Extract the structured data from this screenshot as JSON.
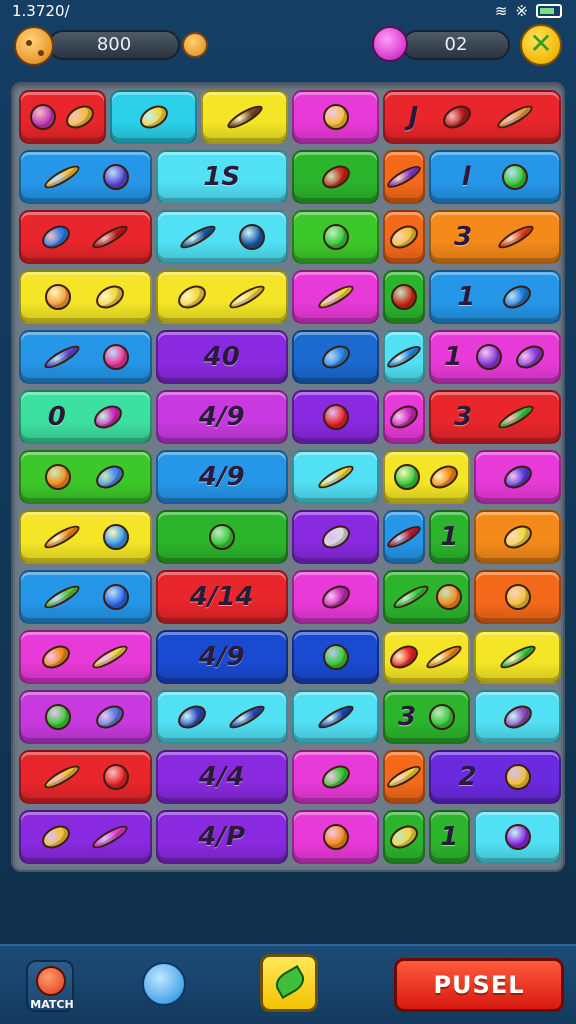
{
  "status": {
    "time": "1.3720/",
    "wifi_icon": "wifi-icon",
    "signal_icon": "signal-icon",
    "battery_icon": "battery-icon"
  },
  "topbar": {
    "coins": "800",
    "gems": "02"
  },
  "board": {
    "tiles": [
      {
        "col": 1,
        "row": 1,
        "span": 2,
        "color": "#e8262b",
        "text": "",
        "glyphs": [
          "#c23ab8",
          "#f4c03a"
        ]
      },
      {
        "col": 3,
        "row": 1,
        "span": 2,
        "color": "#2bd0e8",
        "text": "",
        "glyphs": [
          "#f4d640"
        ]
      },
      {
        "col": 5,
        "row": 1,
        "span": 2,
        "color": "#f4e626",
        "text": "",
        "glyphs": [
          "#7a4a22"
        ]
      },
      {
        "col": 7,
        "row": 1,
        "span": 2,
        "color": "#e83ad8",
        "text": "",
        "glyphs": [
          "#f4c03a"
        ]
      },
      {
        "col": 9,
        "row": 1,
        "span": 4,
        "color": "#e8262b",
        "text": "J",
        "glyphs": [
          "#b81a1a",
          "#e8a040"
        ]
      },
      {
        "col": 1,
        "row": 2,
        "span": 3,
        "color": "#2596e8",
        "text": "",
        "glyphs": [
          "#f4c03a",
          "#5a4ad8"
        ]
      },
      {
        "col": 4,
        "row": 2,
        "span": 3,
        "color": "#52e0f4",
        "text": "1S",
        "glyphs": []
      },
      {
        "col": 7,
        "row": 2,
        "span": 2,
        "color": "#2cb52c",
        "text": "",
        "glyphs": [
          "#c82a1a"
        ]
      },
      {
        "col": 9,
        "row": 2,
        "span": 1,
        "color": "#f46a1a",
        "text": "",
        "glyphs": [
          "#8a3ad8"
        ]
      },
      {
        "col": 10,
        "row": 2,
        "span": 3,
        "color": "#2596e8",
        "text": "l",
        "glyphs": [
          "#3ac83a"
        ]
      },
      {
        "col": 1,
        "row": 3,
        "span": 3,
        "color": "#e8262b",
        "text": "",
        "glyphs": [
          "#2a7ae8",
          "#c81a1a"
        ]
      },
      {
        "col": 4,
        "row": 3,
        "span": 3,
        "color": "#52e0f4",
        "text": "",
        "glyphs": [
          "#1a5aa8",
          "#1a5aa8"
        ]
      },
      {
        "col": 7,
        "row": 3,
        "span": 2,
        "color": "#3cc82a",
        "text": "",
        "glyphs": [
          "#3ac83a"
        ]
      },
      {
        "col": 9,
        "row": 3,
        "span": 1,
        "color": "#f46a1a",
        "text": "",
        "glyphs": [
          "#f4c03a"
        ]
      },
      {
        "col": 10,
        "row": 3,
        "span": 3,
        "color": "#f48a1a",
        "text": "3",
        "glyphs": [
          "#e8401a"
        ]
      },
      {
        "col": 1,
        "row": 4,
        "span": 3,
        "color": "#f4e626",
        "text": "",
        "glyphs": [
          "#f4a03a",
          "#f4d640"
        ]
      },
      {
        "col": 4,
        "row": 4,
        "span": 3,
        "color": "#f4e626",
        "text": "",
        "glyphs": [
          "#f4d640",
          "#f4d640"
        ]
      },
      {
        "col": 7,
        "row": 4,
        "span": 2,
        "color": "#e83ad8",
        "text": "",
        "glyphs": [
          "#f4d640"
        ]
      },
      {
        "col": 9,
        "row": 4,
        "span": 1,
        "color": "#2cb52c",
        "text": "",
        "glyphs": [
          "#c82a1a"
        ]
      },
      {
        "col": 10,
        "row": 4,
        "span": 3,
        "color": "#2596e8",
        "text": "1",
        "glyphs": [
          "#1a7ad8"
        ]
      },
      {
        "col": 1,
        "row": 5,
        "span": 3,
        "color": "#2596e8",
        "text": "",
        "glyphs": [
          "#5a4ad8",
          "#e83a9a"
        ]
      },
      {
        "col": 4,
        "row": 5,
        "span": 3,
        "color": "#8a2ae0",
        "text": "40",
        "glyphs": []
      },
      {
        "col": 7,
        "row": 5,
        "span": 2,
        "color": "#1a6ad0",
        "text": "",
        "glyphs": [
          "#2a8ae8"
        ]
      },
      {
        "col": 9,
        "row": 5,
        "span": 1,
        "color": "#52e0f4",
        "text": "",
        "glyphs": [
          "#2a8ae8"
        ]
      },
      {
        "col": 10,
        "row": 5,
        "span": 3,
        "color": "#e83ad8",
        "text": "1",
        "glyphs": [
          "#8a3ad8",
          "#8a3ad8"
        ]
      },
      {
        "col": 1,
        "row": 6,
        "span": 3,
        "color": "#3ce0a0",
        "text": "0",
        "glyphs": [
          "#c82ab8"
        ]
      },
      {
        "col": 4,
        "row": 6,
        "span": 3,
        "color": "#c83ae0",
        "text": "4/9",
        "glyphs": []
      },
      {
        "col": 7,
        "row": 6,
        "span": 2,
        "color": "#8a2ae0",
        "text": "",
        "glyphs": [
          "#e8262b"
        ]
      },
      {
        "col": 9,
        "row": 6,
        "span": 1,
        "color": "#e83ad8",
        "text": "",
        "glyphs": [
          "#c82ab8"
        ]
      },
      {
        "col": 10,
        "row": 6,
        "span": 3,
        "color": "#e8262b",
        "text": "3",
        "glyphs": [
          "#3ac83a"
        ]
      },
      {
        "col": 1,
        "row": 7,
        "span": 3,
        "color": "#3cc82a",
        "text": "",
        "glyphs": [
          "#f48a1a",
          "#4a8ae8"
        ]
      },
      {
        "col": 4,
        "row": 7,
        "span": 3,
        "color": "#2596e8",
        "text": "4/9",
        "glyphs": []
      },
      {
        "col": 7,
        "row": 7,
        "span": 2,
        "color": "#52e0f4",
        "text": "",
        "glyphs": [
          "#f4d640"
        ]
      },
      {
        "col": 9,
        "row": 7,
        "span": 2,
        "color": "#f4e626",
        "text": "",
        "glyphs": [
          "#3ac83a",
          "#f48a1a"
        ]
      },
      {
        "col": 11,
        "row": 7,
        "span": 2,
        "color": "#e83ad8",
        "text": "",
        "glyphs": [
          "#5a3ad8"
        ]
      },
      {
        "col": 1,
        "row": 8,
        "span": 3,
        "color": "#f4e626",
        "text": "",
        "glyphs": [
          "#f48a1a",
          "#3a9ae8"
        ]
      },
      {
        "col": 4,
        "row": 8,
        "span": 3,
        "color": "#2cb52c",
        "text": "",
        "glyphs": [
          "#3ac83a"
        ]
      },
      {
        "col": 7,
        "row": 8,
        "span": 2,
        "color": "#8a2ae0",
        "text": "",
        "glyphs": [
          "#dcdcdc"
        ]
      },
      {
        "col": 9,
        "row": 8,
        "span": 1,
        "color": "#2596e8",
        "text": "",
        "glyphs": [
          "#c81a3a"
        ]
      },
      {
        "col": 10,
        "row": 8,
        "span": 1,
        "color": "#2cb52c",
        "text": "1",
        "glyphs": []
      },
      {
        "col": 11,
        "row": 8,
        "span": 2,
        "color": "#f48a1a",
        "text": "",
        "glyphs": [
          "#f4d640"
        ]
      },
      {
        "col": 1,
        "row": 9,
        "span": 3,
        "color": "#2596e8",
        "text": "",
        "glyphs": [
          "#5ac83a",
          "#2a6ae8"
        ]
      },
      {
        "col": 4,
        "row": 9,
        "span": 3,
        "color": "#e8262b",
        "text": "4/14",
        "glyphs": []
      },
      {
        "col": 7,
        "row": 9,
        "span": 2,
        "color": "#e83ad8",
        "text": "",
        "glyphs": [
          "#c82ab8"
        ]
      },
      {
        "col": 9,
        "row": 9,
        "span": 2,
        "color": "#2cb52c",
        "text": "",
        "glyphs": [
          "#3ac83a",
          "#f48a1a"
        ]
      },
      {
        "col": 11,
        "row": 9,
        "span": 2,
        "color": "#f46a1a",
        "text": "",
        "glyphs": [
          "#f4c03a"
        ]
      },
      {
        "col": 1,
        "row": 10,
        "span": 3,
        "color": "#e83ad8",
        "text": "",
        "glyphs": [
          "#f48a1a",
          "#f4d640"
        ]
      },
      {
        "col": 4,
        "row": 10,
        "span": 3,
        "color": "#1a4ad0",
        "text": "4/9",
        "glyphs": []
      },
      {
        "col": 7,
        "row": 10,
        "span": 2,
        "color": "#1a4ad0",
        "text": "",
        "glyphs": [
          "#3ac83a"
        ]
      },
      {
        "col": 9,
        "row": 10,
        "span": 2,
        "color": "#f4e626",
        "text": "",
        "glyphs": [
          "#e8262b",
          "#f48a1a"
        ]
      },
      {
        "col": 11,
        "row": 10,
        "span": 2,
        "color": "#f4e626",
        "text": "",
        "glyphs": [
          "#3ac83a"
        ]
      },
      {
        "col": 1,
        "row": 11,
        "span": 3,
        "color": "#c83ae0",
        "text": "",
        "glyphs": [
          "#3ac83a",
          "#5a7ad8"
        ]
      },
      {
        "col": 4,
        "row": 11,
        "span": 3,
        "color": "#52e0f4",
        "text": "",
        "glyphs": [
          "#2a4ab8",
          "#2a4ab8"
        ]
      },
      {
        "col": 7,
        "row": 11,
        "span": 2,
        "color": "#52e0f4",
        "text": "",
        "glyphs": [
          "#1a4ab8"
        ]
      },
      {
        "col": 9,
        "row": 11,
        "span": 2,
        "color": "#2cb52c",
        "text": "3",
        "glyphs": [
          "#3ac83a"
        ]
      },
      {
        "col": 11,
        "row": 11,
        "span": 2,
        "color": "#52e0f4",
        "text": "",
        "glyphs": [
          "#8a4ab8"
        ]
      },
      {
        "col": 1,
        "row": 12,
        "span": 3,
        "color": "#e8262b",
        "text": "",
        "glyphs": [
          "#f4c03a",
          "#e8262b"
        ]
      },
      {
        "col": 4,
        "row": 12,
        "span": 3,
        "color": "#8a2ae0",
        "text": "4/4",
        "glyphs": []
      },
      {
        "col": 7,
        "row": 12,
        "span": 2,
        "color": "#e83ad8",
        "text": "",
        "glyphs": [
          "#3ac83a"
        ]
      },
      {
        "col": 9,
        "row": 12,
        "span": 1,
        "color": "#f46a1a",
        "text": "",
        "glyphs": [
          "#f4d640"
        ]
      },
      {
        "col": 10,
        "row": 12,
        "span": 3,
        "color": "#6a2ae0",
        "text": "2",
        "glyphs": [
          "#f4c03a"
        ]
      },
      {
        "col": 1,
        "row": 13,
        "span": 3,
        "color": "#8a2ae0",
        "text": "",
        "glyphs": [
          "#f4c03a",
          "#e83ad8"
        ]
      },
      {
        "col": 4,
        "row": 13,
        "span": 3,
        "color": "#8a2ae0",
        "text": "4/P",
        "glyphs": []
      },
      {
        "col": 7,
        "row": 13,
        "span": 2,
        "color": "#e83ad8",
        "text": "",
        "glyphs": [
          "#f48a1a"
        ]
      },
      {
        "col": 9,
        "row": 13,
        "span": 1,
        "color": "#2cb52c",
        "text": "",
        "glyphs": [
          "#f4d640"
        ]
      },
      {
        "col": 10,
        "row": 13,
        "span": 1,
        "color": "#2cb52c",
        "text": "1",
        "glyphs": []
      },
      {
        "col": 11,
        "row": 13,
        "span": 2,
        "color": "#52e0f4",
        "text": "",
        "glyphs": [
          "#8a2ae0"
        ]
      }
    ]
  },
  "bottombar": {
    "match_label": "MATCH",
    "pusel_label": "PUSEL"
  },
  "icons": {
    "coin": "cookie-coin-icon",
    "gem": "gem-icon",
    "close": "close-icon",
    "hint": "hint-icon",
    "leaf": "leaf-icon"
  }
}
